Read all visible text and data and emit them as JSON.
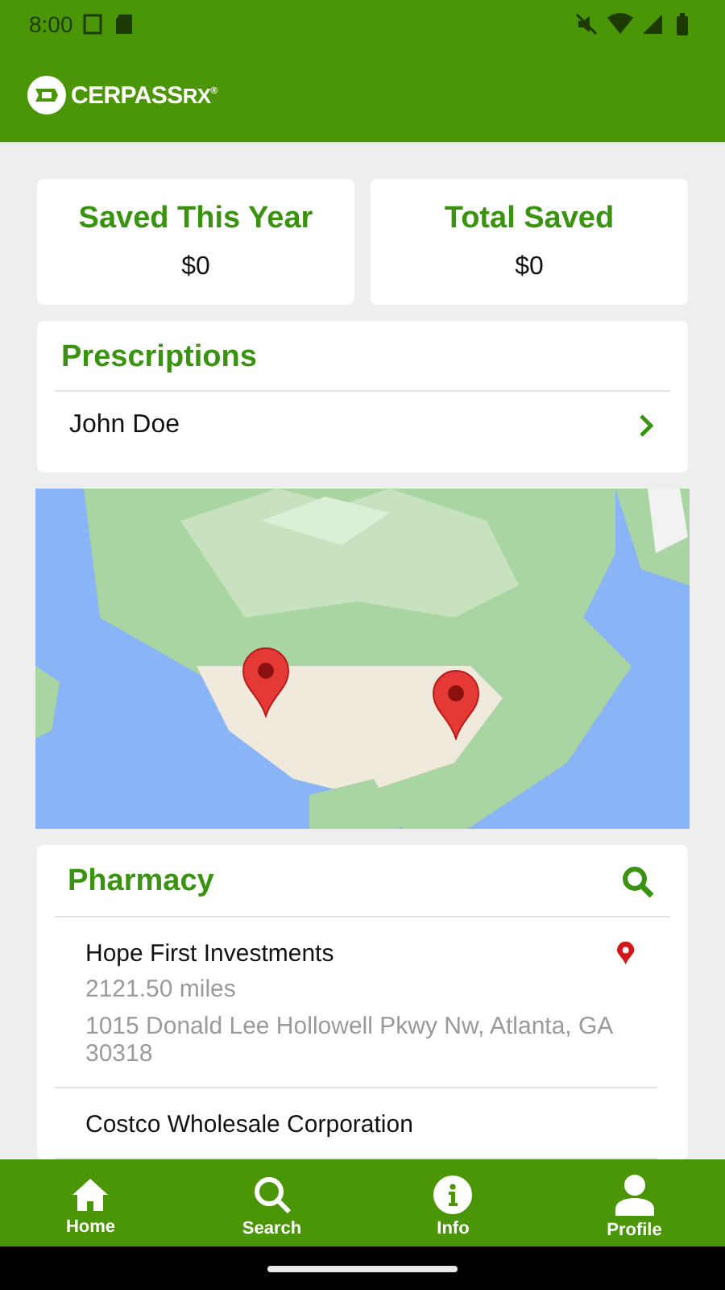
{
  "status_bar": {
    "time": "8:00"
  },
  "app_bar": {
    "logo": {
      "name": "CERPASS",
      "suffix": "RX",
      "mark": "®"
    }
  },
  "summary": [
    {
      "label": "Saved This Year",
      "value": "$0"
    },
    {
      "label": "Total Saved",
      "value": "$0"
    }
  ],
  "prescriptions": {
    "title": "Prescriptions",
    "items": [
      {
        "name": "John Doe"
      }
    ]
  },
  "pharmacy": {
    "title": "Pharmacy",
    "items": [
      {
        "name": "Hope First Investments",
        "distance": "2121.50 miles",
        "address": "1015 Donald Lee Hollowell Pkwy Nw, Atlanta, GA 30318",
        "pinned": true
      },
      {
        "name": "Costco Wholesale Corporation",
        "pinned": false
      }
    ]
  },
  "bottom_nav": [
    {
      "label": "Home",
      "kind": "home"
    },
    {
      "label": "Search",
      "kind": "search"
    },
    {
      "label": "Info",
      "kind": "info"
    },
    {
      "label": "Profile",
      "kind": "profile"
    }
  ]
}
